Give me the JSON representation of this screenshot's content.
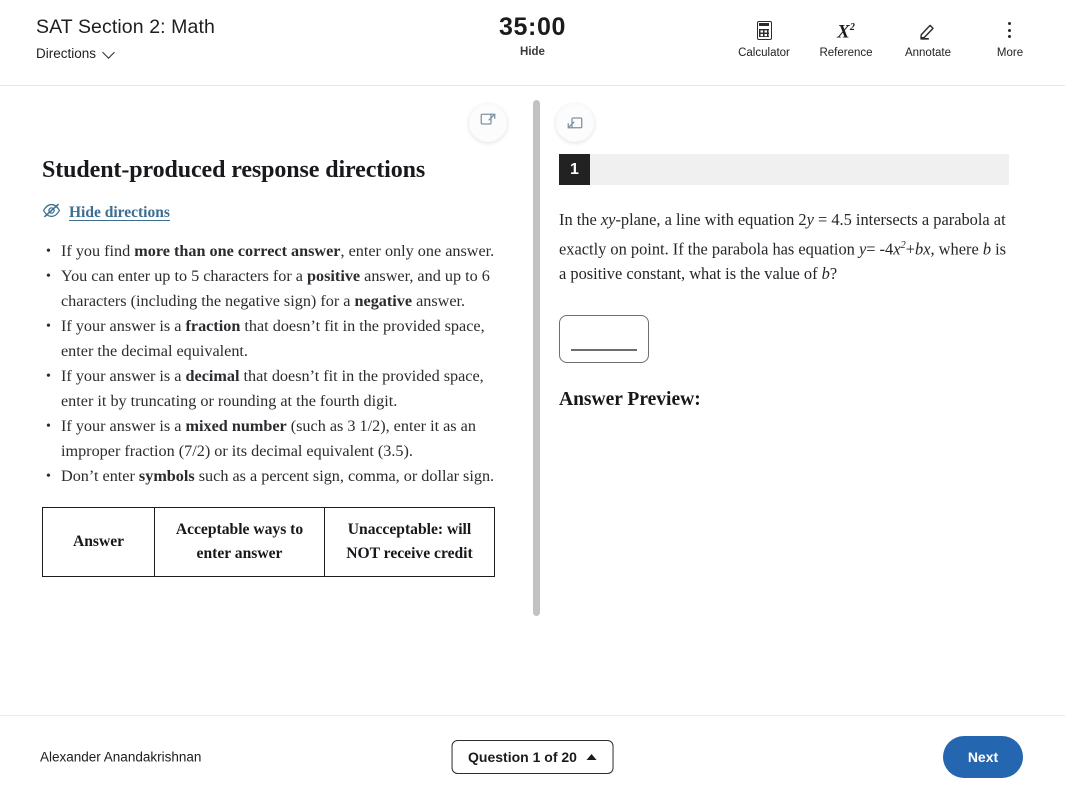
{
  "header": {
    "title": "SAT Section 2: Math",
    "directions_label": "Directions",
    "timer": "35:00",
    "timer_toggle": "Hide",
    "tools": [
      {
        "label": "Calculator",
        "icon": "calculator-icon"
      },
      {
        "label": "Reference",
        "icon": "reference-x-squared-icon"
      },
      {
        "label": "Annotate",
        "icon": "highlighter-pen-icon"
      },
      {
        "label": "More",
        "icon": "more-vertical-dots-icon"
      }
    ]
  },
  "directions": {
    "heading": "Student-produced response directions",
    "hide_link": "Hide directions",
    "bullets": [
      {
        "prefix": "If you find ",
        "bold": "more than one correct answer",
        "suffix": ", enter only one answer."
      },
      {
        "prefix": "You can enter up to 5 characters for a ",
        "bold": "positive",
        "suffix": " answer, and up to 6 characters (including the negative sign) for a ",
        "bold2": "negative",
        "suffix2": " answer."
      },
      {
        "prefix": " If your answer is a ",
        "bold": "fraction",
        "suffix": " that doesn’t fit in the provided space, enter the decimal equivalent."
      },
      {
        "prefix": " If your answer is a ",
        "bold": "decimal",
        "suffix": " that doesn’t fit in the provided space, enter it by truncating or rounding at the fourth digit."
      },
      {
        "prefix": " If your answer is a ",
        "bold": "mixed number",
        "suffix": " (such as 3 1/2), enter it as an improper fraction (7/2) or its decimal equivalent (3.5)."
      },
      {
        "prefix": "Don’t enter ",
        "bold": "symbols",
        "suffix": " such as a percent sign, comma, or dollar sign."
      }
    ],
    "table": {
      "headers": [
        "Answer",
        "Acceptable ways to enter answer",
        "Unacceptable: will NOT receive credit"
      ]
    }
  },
  "question": {
    "number": "1",
    "text_part1": "In the ",
    "text_xy": "xy",
    "text_part2": "-plane, a line with equation 2",
    "text_y1": "y",
    "text_part3": " = 4.5 intersects a parabola at exactly on point. If the parabola has equation ",
    "text_y2": "y",
    "text_part4": "= -4",
    "text_x": "x",
    "text_sup": "2",
    "text_part5": "+",
    "text_b1": "b",
    "text_x2": "x",
    "text_part6": ", where ",
    "text_b2": "b",
    "text_part7": " is a positive constant, what is the value of ",
    "text_b3": "b",
    "text_part8": "?",
    "answer_value": "",
    "answer_preview_label": "Answer Preview:"
  },
  "panel_toggles": {
    "left_icon": "expand-left-panel-icon",
    "right_icon": "collapse-right-panel-icon"
  },
  "footer": {
    "student_name": "Alexander Anandakrishnan",
    "question_nav": "Question 1 of 20",
    "next_label": "Next"
  },
  "colors": {
    "accent_blue": "#2566b0",
    "link_blue": "#3d6e91",
    "badge_dark": "#222222",
    "bar_gray": "#f0f0f0"
  }
}
